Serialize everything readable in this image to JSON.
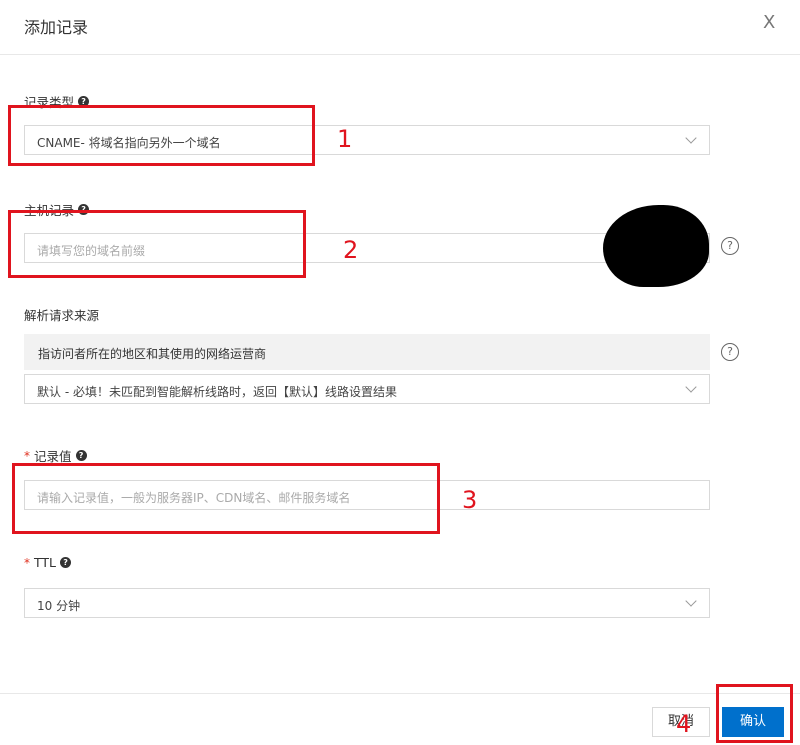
{
  "dialog": {
    "title": "添加记录",
    "close_label": "X"
  },
  "record_type": {
    "label": "记录类型",
    "value": "CNAME- 将域名指向另外一个域名"
  },
  "host_record": {
    "label": "主机记录",
    "placeholder": "请填写您的域名前缀"
  },
  "resolution_source": {
    "label": "解析请求来源",
    "hint": "指访问者所在的地区和其使用的网络运营商",
    "value": "默认 - 必填！未匹配到智能解析线路时，返回【默认】线路设置结果"
  },
  "record_value": {
    "required_mark": "*",
    "label": "记录值",
    "placeholder": "请输入记录值，一般为服务器IP、CDN域名、邮件服务域名"
  },
  "ttl": {
    "required_mark": "*",
    "label": "TTL",
    "value": "10 分钟"
  },
  "footer": {
    "cancel_label": "取消",
    "confirm_label": "确认"
  },
  "annotations": {
    "num1": "1",
    "num2": "2",
    "num3": "3",
    "num4": "4",
    "color": "#e0141e"
  },
  "help_icon_glyph": "?",
  "colors": {
    "primary": "#0070cc",
    "required": "#e0301e"
  }
}
